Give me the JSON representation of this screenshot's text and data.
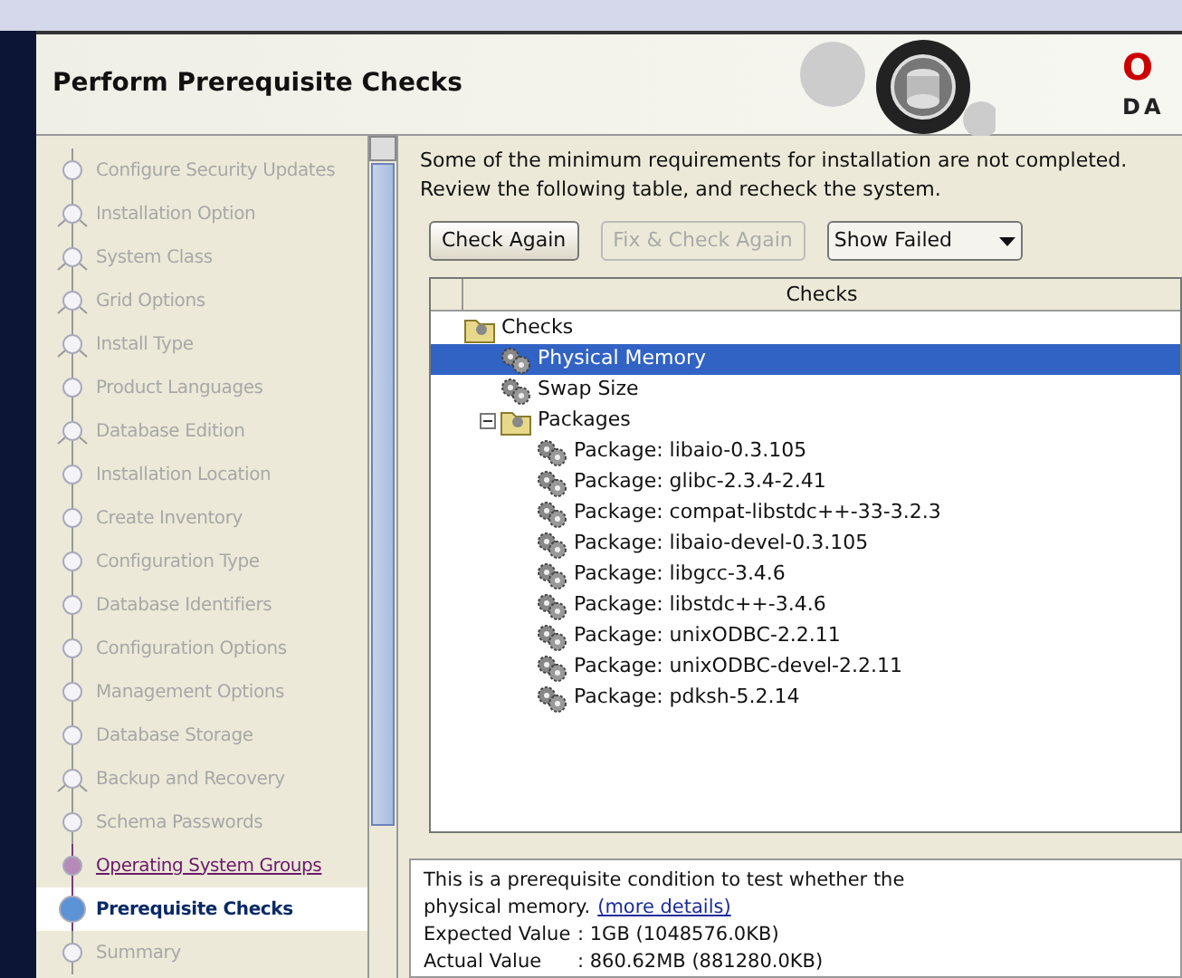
{
  "header": {
    "title": "Perform Prerequisite Checks",
    "brand_fragment": "O",
    "brand_sub": "DA"
  },
  "steps": [
    {
      "label": "Configure Security Updates",
      "kind": "done",
      "branch": false
    },
    {
      "label": "Installation Option",
      "kind": "done",
      "branch": true
    },
    {
      "label": "System Class",
      "kind": "done",
      "branch": true
    },
    {
      "label": "Grid Options",
      "kind": "done",
      "branch": true
    },
    {
      "label": "Install Type",
      "kind": "done",
      "branch": true
    },
    {
      "label": "Product Languages",
      "kind": "done",
      "branch": false
    },
    {
      "label": "Database Edition",
      "kind": "done",
      "branch": true
    },
    {
      "label": "Installation Location",
      "kind": "done",
      "branch": false
    },
    {
      "label": "Create Inventory",
      "kind": "done",
      "branch": false
    },
    {
      "label": "Configuration Type",
      "kind": "done",
      "branch": false
    },
    {
      "label": "Database Identifiers",
      "kind": "done",
      "branch": false
    },
    {
      "label": "Configuration Options",
      "kind": "done",
      "branch": false
    },
    {
      "label": "Management Options",
      "kind": "done",
      "branch": false
    },
    {
      "label": "Database Storage",
      "kind": "done",
      "branch": false
    },
    {
      "label": "Backup and Recovery",
      "kind": "done",
      "branch": true
    },
    {
      "label": "Schema Passwords",
      "kind": "done",
      "branch": false
    },
    {
      "label": "Operating System Groups",
      "kind": "visited",
      "branch": false
    },
    {
      "label": "Prerequisite Checks",
      "kind": "current",
      "branch": false
    },
    {
      "label": "Summary",
      "kind": "pending",
      "branch": false
    }
  ],
  "message": "Some of the minimum requirements for installation are not completed. Review the following table, and recheck the system.",
  "buttons": [
    {
      "label": "Check Again",
      "disabled": false
    },
    {
      "label": "Fix & Check Again",
      "disabled": true
    }
  ],
  "filter": {
    "value": "Show Failed"
  },
  "table": {
    "columns": [
      "Checks"
    ],
    "tree": [
      {
        "label": "Checks",
        "kind": "folder",
        "selected": false,
        "children": [
          {
            "label": "Physical Memory",
            "kind": "check",
            "selected": true
          },
          {
            "label": "Swap Size",
            "kind": "check",
            "selected": false
          },
          {
            "label": "Packages",
            "kind": "folder",
            "expanded": true,
            "selected": false,
            "children": [
              {
                "label": "Package: libaio-0.3.105",
                "kind": "check",
                "selected": false
              },
              {
                "label": "Package: glibc-2.3.4-2.41",
                "kind": "check",
                "selected": false
              },
              {
                "label": "Package: compat-libstdc++-33-3.2.3",
                "kind": "check",
                "selected": false
              },
              {
                "label": "Package: libaio-devel-0.3.105",
                "kind": "check",
                "selected": false
              },
              {
                "label": "Package: libgcc-3.4.6",
                "kind": "check",
                "selected": false
              },
              {
                "label": "Package: libstdc++-3.4.6",
                "kind": "check",
                "selected": false
              },
              {
                "label": "Package: unixODBC-2.2.11",
                "kind": "check",
                "selected": false
              },
              {
                "label": "Package: unixODBC-devel-2.2.11",
                "kind": "check",
                "selected": false
              },
              {
                "label": "Package: pdksh-5.2.14",
                "kind": "check",
                "selected": false
              }
            ]
          }
        ]
      }
    ]
  },
  "details": {
    "line1": "This is a prerequisite condition to test whether the",
    "line2": "physical memory.",
    "link": "(more details)",
    "values": [
      {
        "label": "Expected Value",
        "value": ": 1GB (1048576.0KB)"
      },
      {
        "label": "Actual Value",
        "value": ": 860.62MB (881280.0KB)"
      }
    ]
  }
}
